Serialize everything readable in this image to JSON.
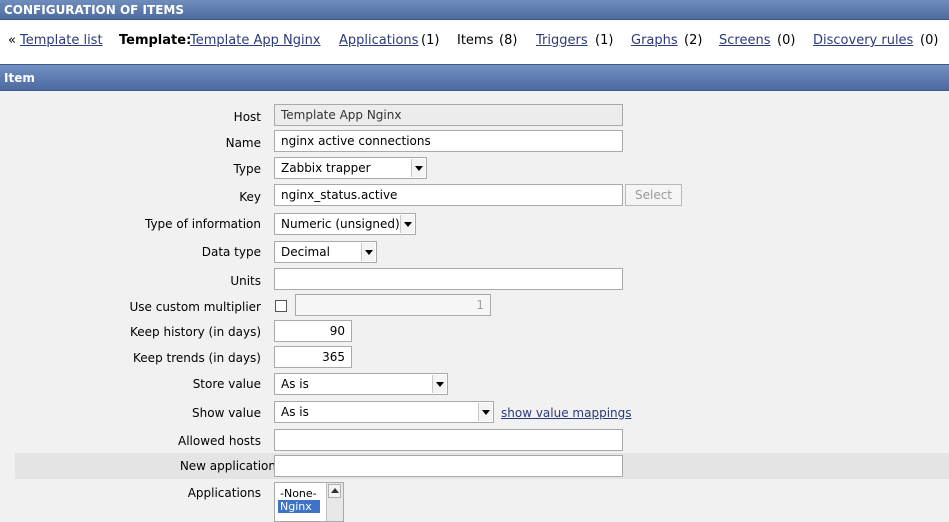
{
  "title": "CONFIGURATION OF ITEMS",
  "nav": {
    "back_marker": "«",
    "template_list": "Template list",
    "template_label": "Template:",
    "template_name": "Template App Nginx",
    "applications": "Applications",
    "applications_count": "(1)",
    "items": "Items",
    "items_count": "(8)",
    "triggers": "Triggers",
    "triggers_count": "(1)",
    "graphs": "Graphs",
    "graphs_count": "(2)",
    "screens": "Screens",
    "screens_count": "(0)",
    "discovery_rules": "Discovery rules",
    "discovery_rules_count": "(0)"
  },
  "section_title": "Item",
  "form": {
    "host": {
      "label": "Host",
      "value": "Template App Nginx"
    },
    "name": {
      "label": "Name",
      "value": "nginx active connections"
    },
    "type": {
      "label": "Type",
      "value": "Zabbix trapper"
    },
    "key": {
      "label": "Key",
      "value": "nginx_status.active",
      "select_button": "Select"
    },
    "type_of_information": {
      "label": "Type of information",
      "value": "Numeric (unsigned)"
    },
    "data_type": {
      "label": "Data type",
      "value": "Decimal"
    },
    "units": {
      "label": "Units",
      "value": ""
    },
    "custom_multiplier": {
      "label": "Use custom multiplier",
      "checked": false,
      "value": "1"
    },
    "keep_history": {
      "label": "Keep history (in days)",
      "value": "90"
    },
    "keep_trends": {
      "label": "Keep trends (in days)",
      "value": "365"
    },
    "store_value": {
      "label": "Store value",
      "value": "As is"
    },
    "show_value": {
      "label": "Show value",
      "value": "As is",
      "mappings_link": "show value mappings"
    },
    "allowed_hosts": {
      "label": "Allowed hosts",
      "value": ""
    },
    "new_application": {
      "label": "New application",
      "value": ""
    },
    "applications": {
      "label": "Applications",
      "options": [
        "-None-",
        "Nginx"
      ],
      "selected": "Nginx"
    }
  }
}
